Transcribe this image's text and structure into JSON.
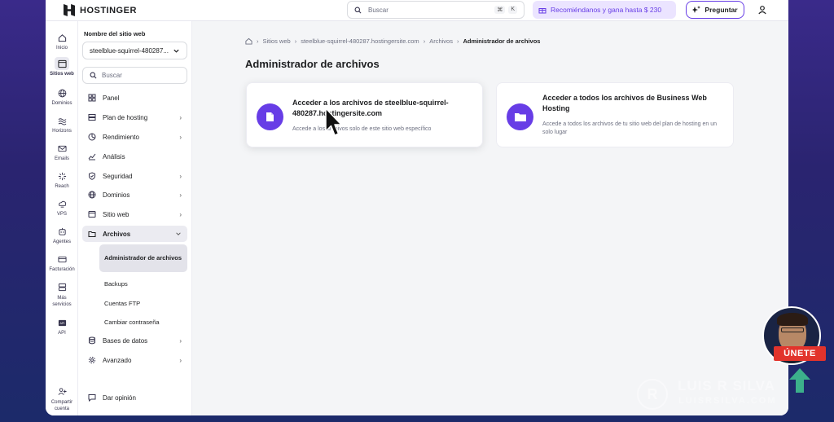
{
  "topbar": {
    "brand": "HOSTINGER",
    "search_placeholder": "Buscar",
    "shortcut_1": "⌘",
    "shortcut_2": "K",
    "promo": "Recomiéndanos y gana hasta $ 230",
    "ask": "Preguntar"
  },
  "rail": {
    "items": [
      {
        "label": "Inicio",
        "icon": "home-icon"
      },
      {
        "label": "Sitios web",
        "icon": "websites-icon"
      },
      {
        "label": "Dominios",
        "icon": "globe-icon"
      },
      {
        "label": "Horizons",
        "icon": "horizons-icon"
      },
      {
        "label": "Emails",
        "icon": "mail-icon"
      },
      {
        "label": "Reach",
        "icon": "reach-icon"
      },
      {
        "label": "VPS",
        "icon": "vps-icon"
      },
      {
        "label": "Agentes",
        "icon": "agents-icon"
      },
      {
        "label": "Facturación",
        "icon": "billing-icon"
      },
      {
        "label": "Más servicios",
        "icon": "more-services-icon"
      },
      {
        "label": "API",
        "icon": "api-icon"
      },
      {
        "label": "Compartir cuenta",
        "icon": "share-account-icon"
      }
    ]
  },
  "sidebar": {
    "title": "Nombre del sitio web",
    "site": "steelblue-squirrel-480287...",
    "search_placeholder": "Buscar",
    "items": [
      {
        "label": "Panel"
      },
      {
        "label": "Plan de hosting"
      },
      {
        "label": "Rendimiento"
      },
      {
        "label": "Análisis"
      },
      {
        "label": "Seguridad"
      },
      {
        "label": "Dominios"
      },
      {
        "label": "Sitio web"
      },
      {
        "label": "Archivos"
      },
      {
        "label": "Bases de datos"
      },
      {
        "label": "Avanzado"
      }
    ],
    "sub_items": [
      {
        "label": "Administrador de archivos"
      },
      {
        "label": "Backups"
      },
      {
        "label": "Cuentas FTP"
      },
      {
        "label": "Cambiar contraseña"
      }
    ],
    "feedback": "Dar opinión"
  },
  "breadcrumb": {
    "items": [
      "Sitios web",
      "steelblue-squirrel-480287.hostingersite.com",
      "Archivos"
    ],
    "current": "Administrador de archivos"
  },
  "page": {
    "title": "Administrador de archivos"
  },
  "cards": [
    {
      "title": "Acceder a los archivos de steelblue-squirrel-480287.hostingersite.com",
      "description": "Accede a los archivos solo de este sitio web específico"
    },
    {
      "title": "Acceder a todos los archivos de Business Web Hosting",
      "description": "Accede a todos los archivos de tu sitio web del plan de hosting en un solo lugar"
    }
  ],
  "overlay": {
    "badge": "ÚNETE",
    "watermark_name": "LUIS R SILVA",
    "watermark_url": "LUISRSILVA.COM",
    "watermark_logo": "R"
  },
  "colors": {
    "accent": "#673de6",
    "accent_light": "#ebe4ff",
    "badge": "#e2332c",
    "arrow": "#3fbf8f"
  }
}
